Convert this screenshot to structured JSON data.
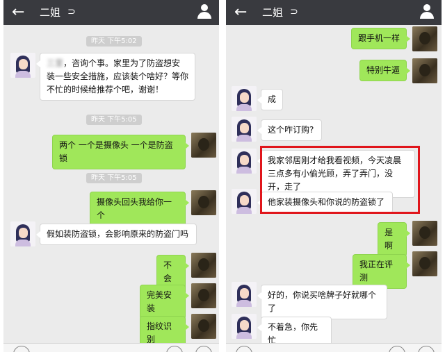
{
  "left_panel": {
    "header": {
      "title": "二姐",
      "back_icon": "←",
      "ear_icon": "ear-icon",
      "user_icon": "person-icon"
    },
    "messages": [
      {
        "type": "timestamp",
        "text": "昨天 下午5:02"
      },
      {
        "type": "incoming",
        "prefix": "三里",
        "text": "，咨询个事。家里为了防盗想安装一些安全措施，应该装个啥好？等你不忙的时候给推荐个吧，谢谢！"
      },
      {
        "type": "timestamp",
        "text": "昨天 下午5:05"
      },
      {
        "type": "outgoing",
        "text": "两个 一个是摄像头 一个是防盗锁"
      },
      {
        "type": "timestamp",
        "text": "昨天 下午5:05"
      },
      {
        "type": "outgoing",
        "text": "摄像头回头我给你一个"
      },
      {
        "type": "incoming",
        "text": "假如装防盗锁，会影响原来的防盗门吗"
      },
      {
        "type": "outgoing",
        "text": "不会"
      },
      {
        "type": "outgoing",
        "text": "完美安装"
      },
      {
        "type": "outgoing",
        "text": "指纹识别"
      }
    ]
  },
  "right_panel": {
    "header": {
      "title": "二姐",
      "back_icon": "←",
      "ear_icon": "ear-icon",
      "user_icon": "person-icon"
    },
    "messages": [
      {
        "type": "outgoing",
        "text": "跟手机一样"
      },
      {
        "type": "outgoing",
        "text": "特别牛逼"
      },
      {
        "type": "incoming",
        "text": "成"
      },
      {
        "type": "incoming",
        "text": "这个咋订购?"
      },
      {
        "type": "incoming",
        "text": "我家邻居刚才给我看视频，今天凌晨三点多有小偷光顾，弄了弄门，没开，走了"
      },
      {
        "type": "incoming",
        "text": "他家装摄像头和你说的防盗锁了"
      },
      {
        "type": "outgoing",
        "text": "是啊"
      },
      {
        "type": "outgoing",
        "text": "我正在评测"
      },
      {
        "type": "incoming",
        "text": "好的，你说买啥牌子好就哪个了"
      },
      {
        "type": "incoming",
        "text": "不着急，你先忙"
      }
    ]
  },
  "colors": {
    "header": "#393a3f",
    "chat_bg": "#ebebeb",
    "outgoing_bubble": "#a0e75a",
    "incoming_bubble": "#ffffff",
    "highlight": "#e0151b"
  }
}
